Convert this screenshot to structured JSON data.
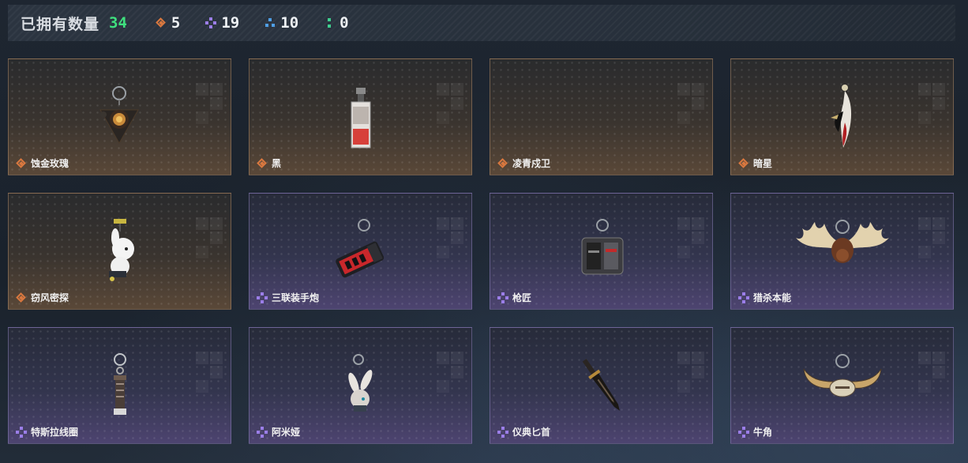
{
  "header": {
    "owned_label": "已拥有数量",
    "owned_count": "34",
    "rarity_counts": [
      {
        "icon": "orange-diamond-gem-icon",
        "color": "#d9783f",
        "count": "5"
      },
      {
        "icon": "purple-cluster-gem-icon",
        "color": "#9b7ee8",
        "count": "19"
      },
      {
        "icon": "blue-cluster-gem-icon",
        "color": "#4f9fe6",
        "count": "10"
      },
      {
        "icon": "green-dots-gem-icon",
        "color": "#3fd08f",
        "count": "0"
      }
    ]
  },
  "items": [
    {
      "name": "蚀金玫瑰",
      "rarity": "orange",
      "icon": "golden-rose-charm-icon"
    },
    {
      "name": "黑",
      "rarity": "orange",
      "icon": "black-card-charm-icon"
    },
    {
      "name": "凌青戍卫",
      "rarity": "orange",
      "icon": "empty-charm-slot"
    },
    {
      "name": "暗星",
      "rarity": "orange",
      "icon": "dark-star-feather-charm-icon"
    },
    {
      "name": "窃风密探",
      "rarity": "orange",
      "icon": "rabbit-spy-charm-icon"
    },
    {
      "name": "三联装手炮",
      "rarity": "purple",
      "icon": "triple-hand-cannon-charm-icon"
    },
    {
      "name": "枪匠",
      "rarity": "purple",
      "icon": "gunsmith-case-charm-icon"
    },
    {
      "name": "猎杀本能",
      "rarity": "purple",
      "icon": "moose-antler-charm-icon"
    },
    {
      "name": "特斯拉线圈",
      "rarity": "purple",
      "icon": "tesla-coil-charm-icon"
    },
    {
      "name": "阿米娅",
      "rarity": "purple",
      "icon": "amiya-bunny-charm-icon"
    },
    {
      "name": "仪典匕首",
      "rarity": "purple",
      "icon": "ceremonial-dagger-charm-icon"
    },
    {
      "name": "牛角",
      "rarity": "purple",
      "icon": "bull-horns-charm-icon"
    }
  ]
}
